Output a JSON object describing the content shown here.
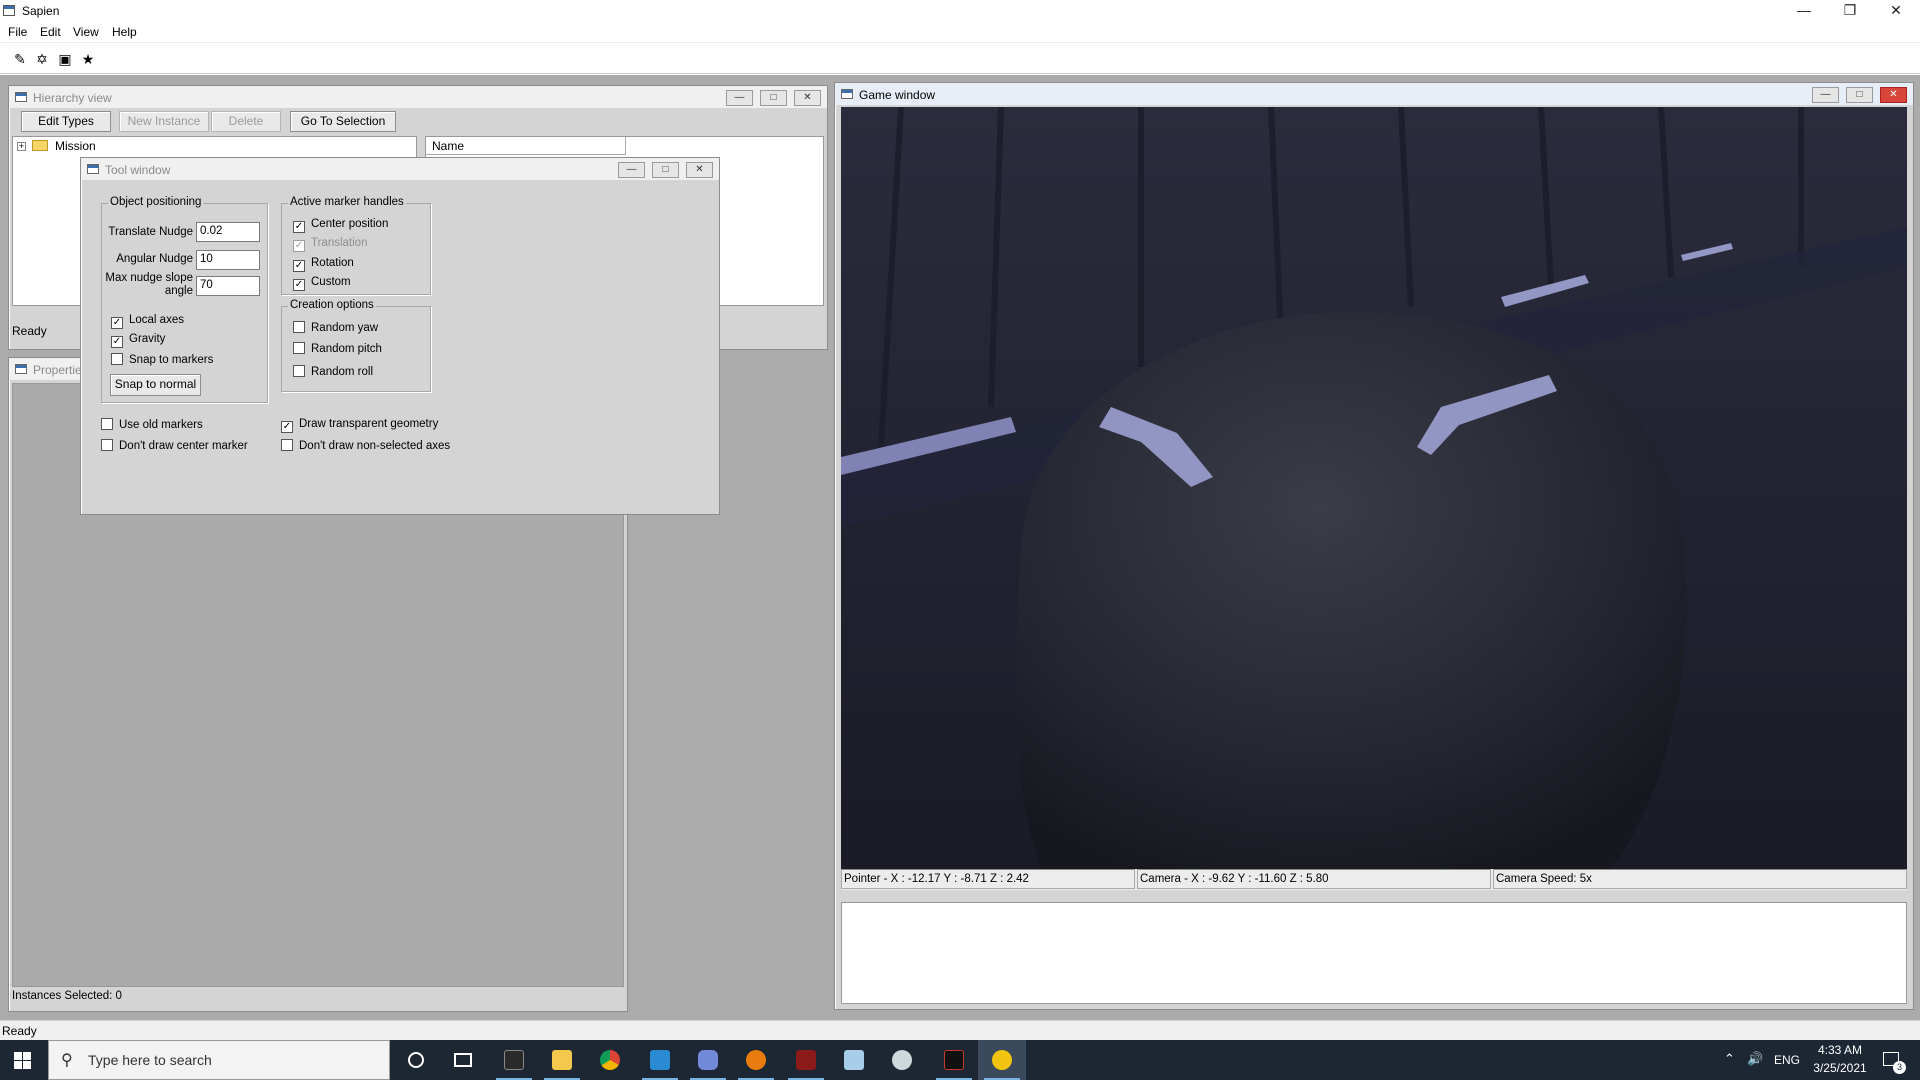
{
  "app": {
    "title": "Sapien"
  },
  "menu": [
    "File",
    "Edit",
    "View",
    "Help"
  ],
  "toolbar_icons": [
    "pencil-icon",
    "pathfinding-icon",
    "camera-icon",
    "player-icon"
  ],
  "hierarchy": {
    "title": "Hierarchy view",
    "buttons": {
      "edit_types": "Edit Types",
      "new_instance": "New Instance",
      "delete": "Delete",
      "go_to_selection": "Go To Selection"
    },
    "tree_root": "Mission",
    "column_name": "Name",
    "status": "Ready"
  },
  "properties": {
    "title": "Properties",
    "status": "Instances Selected: 0"
  },
  "tool": {
    "title": "Tool window",
    "object_positioning": {
      "label": "Object positioning",
      "translate_nudge_label": "Translate Nudge",
      "translate_nudge_value": "0.02",
      "angular_nudge_label": "Angular Nudge",
      "angular_nudge_value": "10",
      "max_nudge_label_1": "Max nudge slope",
      "max_nudge_label_2": "angle",
      "max_nudge_value": "70",
      "local_axes": "Local axes",
      "gravity": "Gravity",
      "snap_to_markers": "Snap to markers",
      "snap_to_normal": "Snap to normal"
    },
    "marker_handles": {
      "label": "Active marker handles",
      "center_position": "Center position",
      "translation": "Translation",
      "rotation": "Rotation",
      "custom": "Custom"
    },
    "creation_options": {
      "label": "Creation options",
      "random_yaw": "Random yaw",
      "random_pitch": "Random pitch",
      "random_roll": "Random roll"
    },
    "use_old_markers": "Use old markers",
    "dont_draw_center_marker": "Don't draw center marker",
    "draw_transparent_geometry": "Draw transparent geometry",
    "dont_draw_non_selected_axes": "Don't draw non-selected axes"
  },
  "game": {
    "title": "Game window",
    "pointer": "Pointer - X : -12.17  Y : -8.71  Z : 2.42",
    "camera": "Camera - X : -9.62  Y : -11.60  Z : 5.80",
    "camera_speed": "Camera Speed: 5x"
  },
  "status": "Ready",
  "taskbar": {
    "search_placeholder": "Type here to search",
    "language": "ENG",
    "time": "4:33 AM",
    "date": "3/25/2021",
    "notification_count": "3"
  },
  "colors": {
    "mdi_background": "#ababab",
    "taskbar": "#1c2733",
    "viewport": "#1f2130"
  }
}
